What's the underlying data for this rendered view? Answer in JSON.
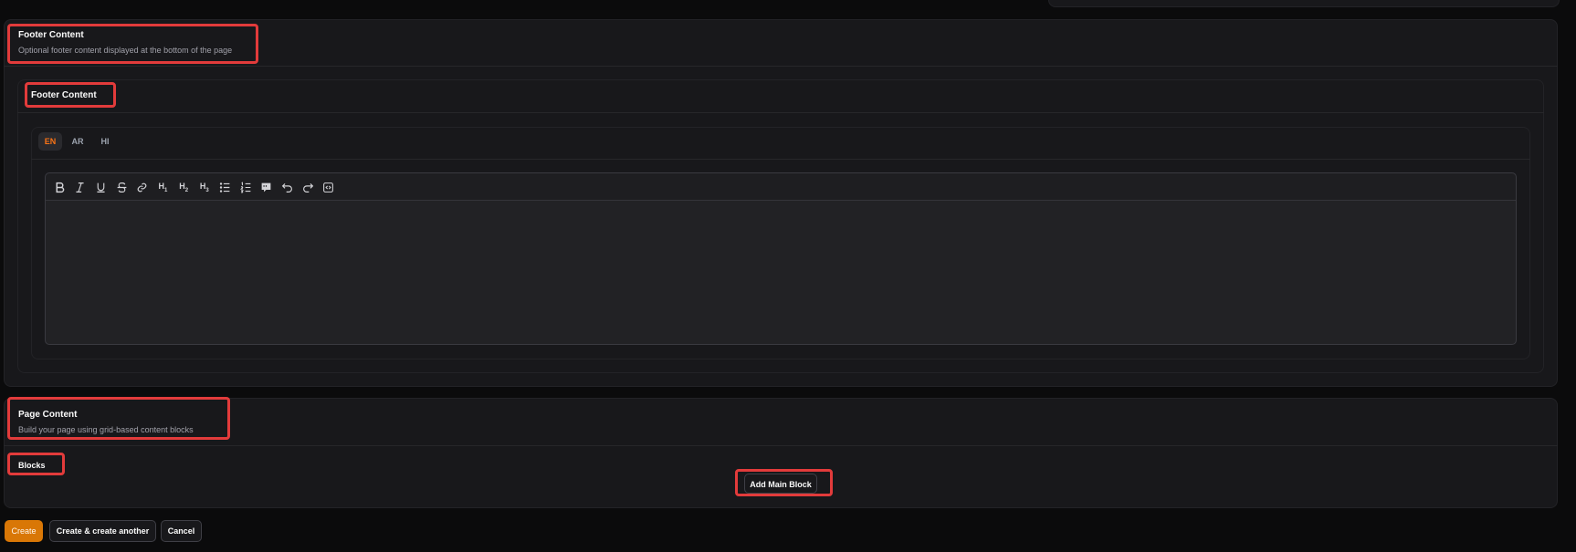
{
  "footer_section": {
    "title": "Footer Content",
    "description": "Optional footer content displayed at the bottom of the page",
    "field_label": "Footer Content",
    "languages": [
      "EN",
      "AR",
      "HI"
    ],
    "active_language": "EN",
    "toolbar": [
      "bold-icon",
      "italic-icon",
      "underline-icon",
      "strikethrough-icon",
      "link-icon",
      "heading-1-icon",
      "heading-2-icon",
      "heading-3-icon",
      "bullet-list-icon",
      "ordered-list-icon",
      "blockquote-icon",
      "undo-icon",
      "redo-icon",
      "code-block-icon"
    ],
    "heading_buttons": {
      "h1": "H",
      "h2": "H",
      "h3": "H",
      "n1": "1",
      "n2": "2",
      "n3": "3"
    }
  },
  "page_content_section": {
    "title": "Page Content",
    "description": "Build your page using grid-based content blocks",
    "blocks_label": "Blocks",
    "add_block_label": "Add Main Block"
  },
  "actions": {
    "create": "Create",
    "create_another": "Create & create another",
    "cancel": "Cancel"
  },
  "colors": {
    "accent": "#d97706",
    "active_tab": "#f97316",
    "highlight": "#e23b3b"
  }
}
